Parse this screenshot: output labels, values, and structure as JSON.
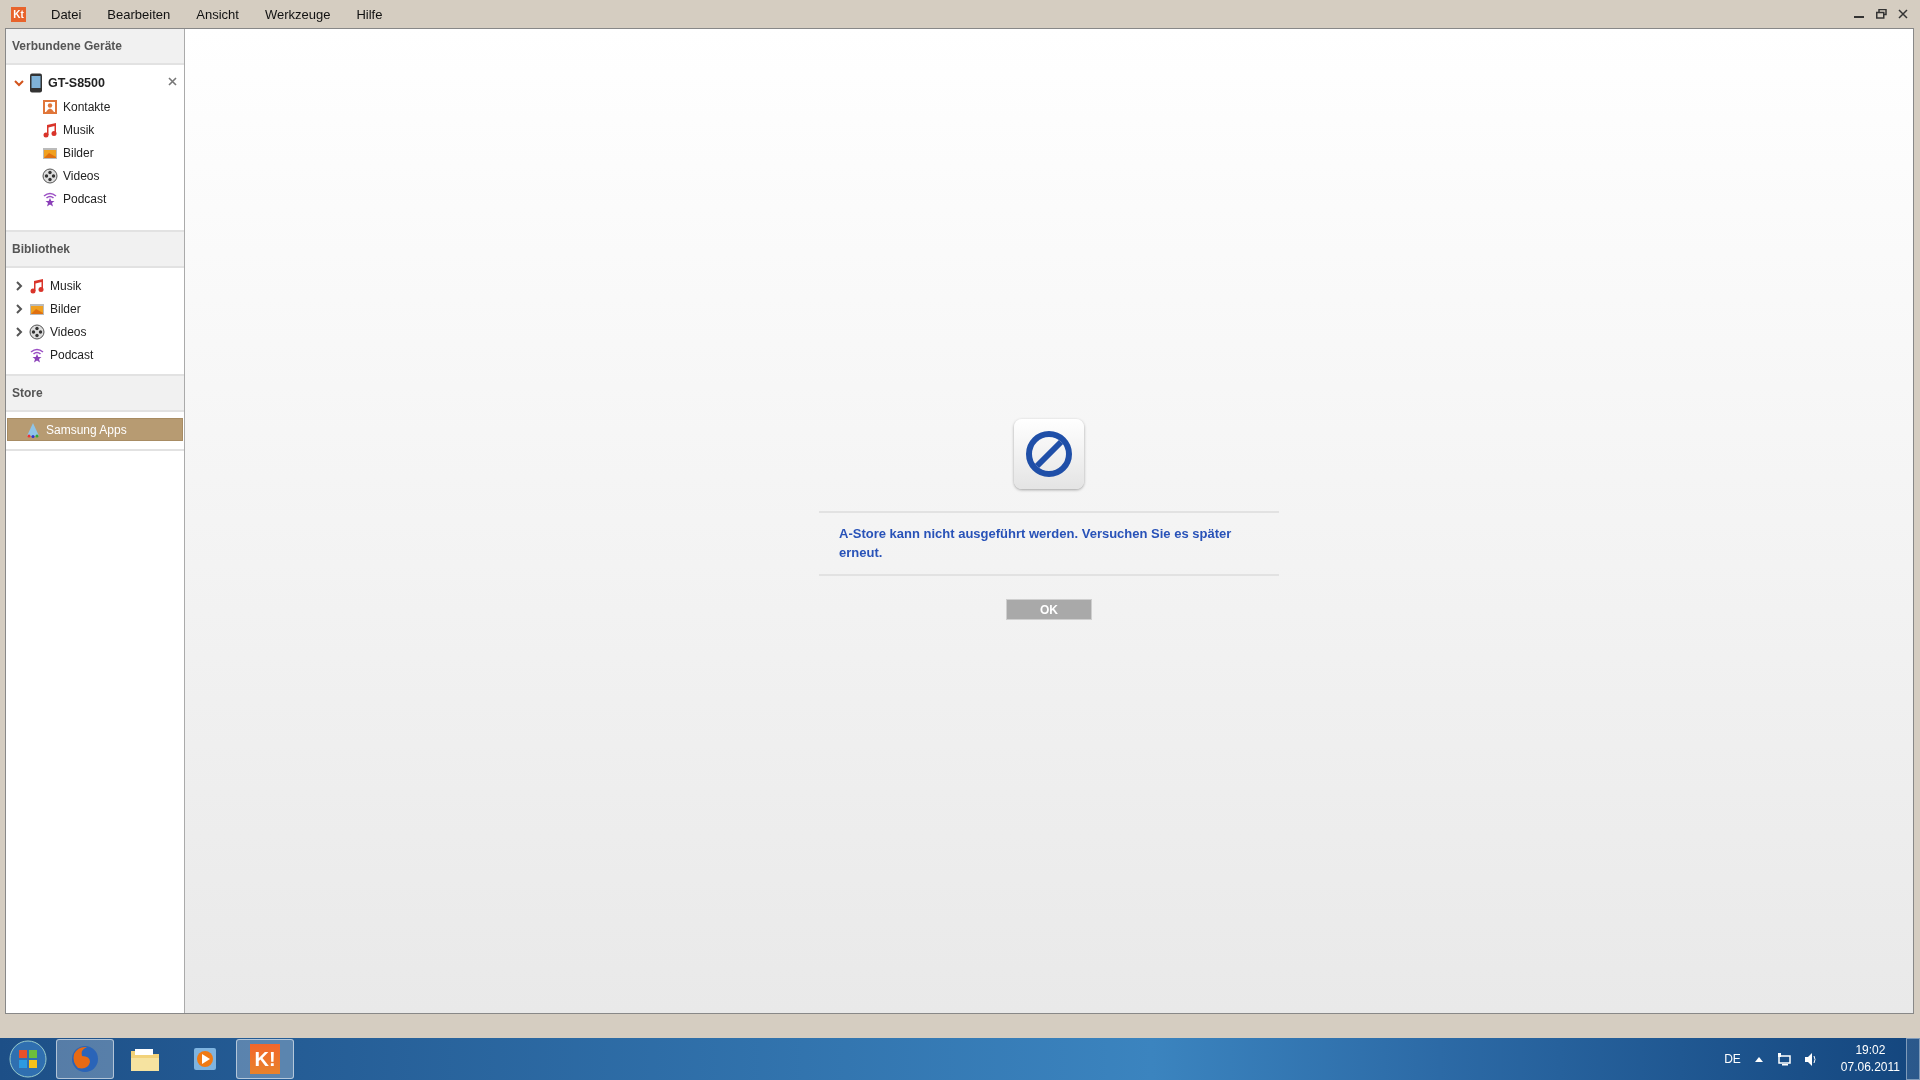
{
  "window": {
    "logo": "Kt",
    "menu": [
      "Datei",
      "Bearbeiten",
      "Ansicht",
      "Werkzeuge",
      "Hilfe"
    ]
  },
  "sidebar": {
    "sections": [
      {
        "title": "Verbundene Geräte",
        "items": [
          {
            "label": "GT-S8500",
            "kind": "phone",
            "expanded": true,
            "selected": false,
            "children": [
              {
                "label": "Kontakte",
                "kind": "contacts",
                "selected": false
              },
              {
                "label": "Musik",
                "kind": "music",
                "selected": false
              },
              {
                "label": "Bilder",
                "kind": "pictures",
                "selected": false
              },
              {
                "label": "Videos",
                "kind": "videos",
                "selected": false
              },
              {
                "label": "Podcast",
                "kind": "podcast",
                "selected": false
              }
            ]
          }
        ]
      },
      {
        "title": "Bibliothek",
        "items": [
          {
            "label": "Musik",
            "kind": "music",
            "expanded": false,
            "selected": false
          },
          {
            "label": "Bilder",
            "kind": "pictures",
            "expanded": false,
            "selected": false
          },
          {
            "label": "Videos",
            "kind": "videos",
            "expanded": false,
            "selected": false
          },
          {
            "label": "Podcast",
            "kind": "podcast",
            "selected": false
          }
        ]
      },
      {
        "title": "Store",
        "items": [
          {
            "label": "Samsung Apps",
            "kind": "apps",
            "selected": true
          }
        ]
      }
    ]
  },
  "dialog": {
    "message": "A-Store kann nicht ausgeführt werden. Versuchen Sie es später erneut.",
    "button": "OK"
  },
  "taskbar": {
    "apps": [
      {
        "kind": "firefox",
        "running": true
      },
      {
        "kind": "explorer",
        "running": false
      },
      {
        "kind": "mediaplayer",
        "running": false
      },
      {
        "kind": "kies",
        "running": true,
        "label": "K!"
      }
    ],
    "language": "DE",
    "time": "19:02",
    "date": "07.06.2011"
  }
}
